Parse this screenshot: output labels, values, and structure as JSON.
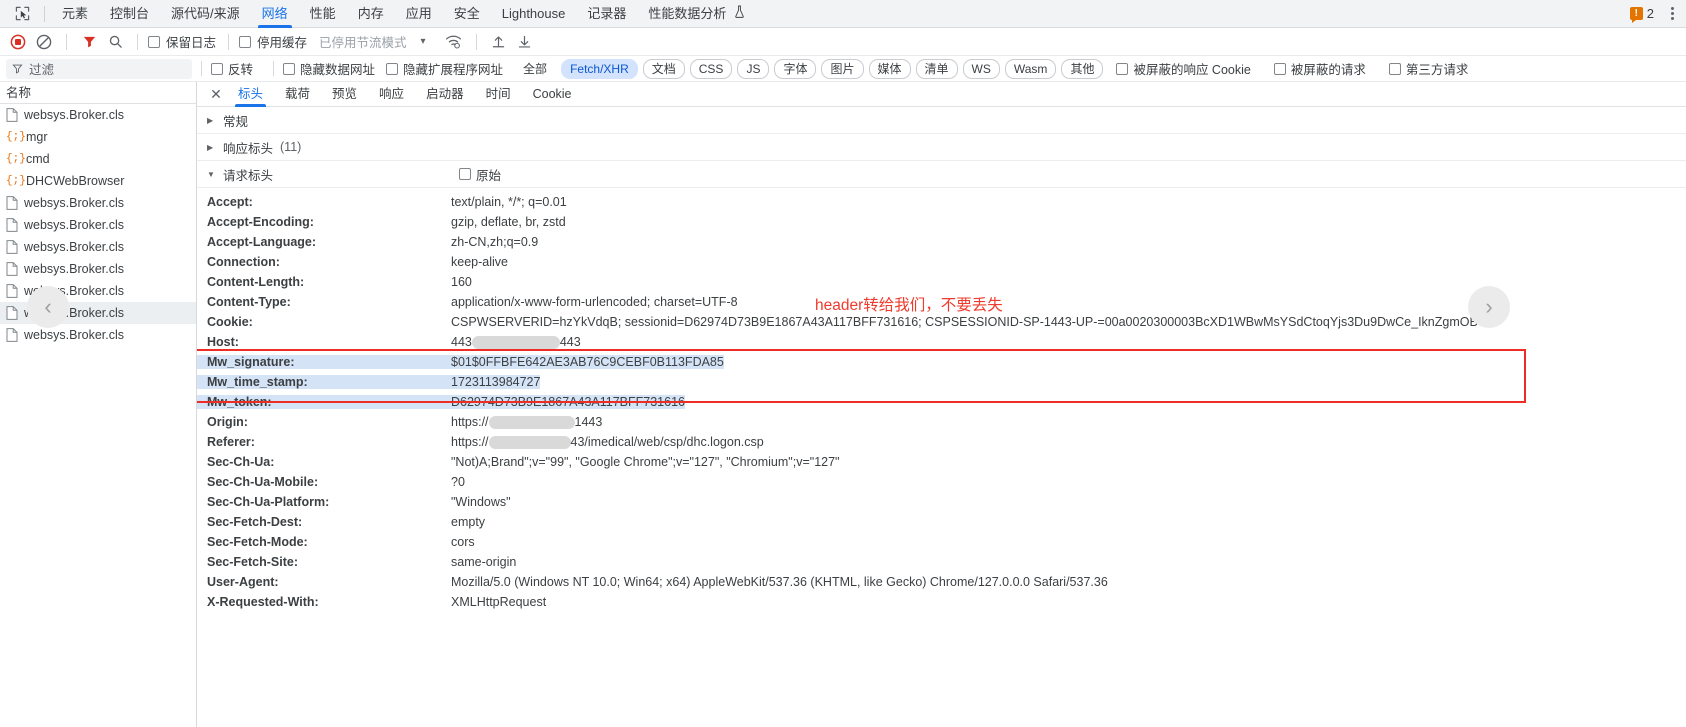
{
  "devtools": {
    "tabs": [
      {
        "label": "元素",
        "active": false
      },
      {
        "label": "控制台",
        "active": false
      },
      {
        "label": "源代码/来源",
        "active": false
      },
      {
        "label": "网络",
        "active": true
      },
      {
        "label": "性能",
        "active": false
      },
      {
        "label": "内存",
        "active": false
      },
      {
        "label": "应用",
        "active": false
      },
      {
        "label": "安全",
        "active": false
      },
      {
        "label": "Lighthouse",
        "active": false
      },
      {
        "label": "记录器",
        "active": false
      },
      {
        "label": "性能数据分析",
        "active": false
      }
    ],
    "flask_icon": "flask-icon",
    "inspect_icon": "inspect-element-icon",
    "warning_count": "2",
    "warning_badge_glyph": "!",
    "more_icon": "kebab-menu-icon"
  },
  "toolbar": {
    "record_icon": "record-stop-icon",
    "clear_icon": "clear-network-log-icon",
    "filter_icon": "filter-funnel-icon",
    "search_icon": "search-icon",
    "preserve_log": "保留日志",
    "disable_cache": "停用缓存",
    "throttling": "已停用节流模式",
    "throttle_caret": "▾",
    "wifi_icon": "network-conditions-icon",
    "import_icon": "import-har-icon",
    "export_icon": "export-har-icon"
  },
  "filterbar": {
    "filter_placeholder": "过滤",
    "filter_value": "",
    "invert": "反转",
    "hide_data_urls": "隐藏数据网址",
    "hide_extension_urls": "隐藏扩展程序网址",
    "types": [
      {
        "label": "全部",
        "selected": false
      },
      {
        "label": "Fetch/XHR",
        "selected": true
      },
      {
        "label": "文档",
        "selected": false
      },
      {
        "label": "CSS",
        "selected": false
      },
      {
        "label": "JS",
        "selected": false
      },
      {
        "label": "字体",
        "selected": false
      },
      {
        "label": "图片",
        "selected": false
      },
      {
        "label": "媒体",
        "selected": false
      },
      {
        "label": "清单",
        "selected": false
      },
      {
        "label": "WS",
        "selected": false
      },
      {
        "label": "Wasm",
        "selected": false
      },
      {
        "label": "其他",
        "selected": false
      }
    ],
    "blocked_cookies": "被屏蔽的响应 Cookie",
    "blocked_requests": "被屏蔽的请求",
    "third_party": "第三方请求"
  },
  "sidebar": {
    "header": "名称",
    "rows": [
      {
        "name": "websys.Broker.cls",
        "icon": "document-icon",
        "selected": false
      },
      {
        "name": "mgr",
        "icon": "js-icon",
        "selected": false
      },
      {
        "name": "cmd",
        "icon": "js-icon",
        "selected": false
      },
      {
        "name": "DHCWebBrowser",
        "icon": "js-icon",
        "selected": false
      },
      {
        "name": "websys.Broker.cls",
        "icon": "document-icon",
        "selected": false
      },
      {
        "name": "websys.Broker.cls",
        "icon": "document-icon",
        "selected": false
      },
      {
        "name": "websys.Broker.cls",
        "icon": "document-icon",
        "selected": false
      },
      {
        "name": "websys.Broker.cls",
        "icon": "document-icon",
        "selected": false
      },
      {
        "name": "websys.Broker.cls",
        "icon": "document-icon",
        "selected": false
      },
      {
        "name": "websys.Broker.cls",
        "icon": "document-icon",
        "selected": true
      },
      {
        "name": "websys.Broker.cls",
        "icon": "document-icon",
        "selected": false
      }
    ]
  },
  "detail": {
    "close_icon": "close-icon",
    "tabs": [
      {
        "label": "标头",
        "active": true
      },
      {
        "label": "载荷",
        "active": false
      },
      {
        "label": "预览",
        "active": false
      },
      {
        "label": "响应",
        "active": false
      },
      {
        "label": "启动器",
        "active": false
      },
      {
        "label": "时间",
        "active": false
      },
      {
        "label": "Cookie",
        "active": false
      }
    ],
    "sections": [
      {
        "label": "常规",
        "expanded": false,
        "count": ""
      },
      {
        "label": "响应标头",
        "expanded": false,
        "count": "(11)"
      },
      {
        "label": "请求标头",
        "expanded": true,
        "count": ""
      }
    ],
    "raw_label": "原始",
    "request_headers": [
      {
        "name": "Accept:",
        "value": "text/plain, */*; q=0.01",
        "highlight": false,
        "redacted": false
      },
      {
        "name": "Accept-Encoding:",
        "value": "gzip, deflate, br, zstd",
        "highlight": false,
        "redacted": false
      },
      {
        "name": "Accept-Language:",
        "value": "zh-CN,zh;q=0.9",
        "highlight": false,
        "redacted": false
      },
      {
        "name": "Connection:",
        "value": "keep-alive",
        "highlight": false,
        "redacted": false
      },
      {
        "name": "Content-Length:",
        "value": "160",
        "highlight": false,
        "redacted": false
      },
      {
        "name": "Content-Type:",
        "value": "application/x-www-form-urlencoded; charset=UTF-8",
        "highlight": false,
        "redacted": false
      },
      {
        "name": "Cookie:",
        "value": "CSPWSERVERID=hzYkVdqB; sessionid=D62974D73B9E1867A43A117BFF731616; CSPSESSIONID-SP-1443-UP-=00a0020300003BcXD1WBwMsYSdCtoqYjs3Du9DwCe_IknZgmOB",
        "highlight": false,
        "redacted": false
      },
      {
        "name": "Host:",
        "value": "443",
        "highlight": false,
        "redacted": true
      },
      {
        "name": "Mw_signature:",
        "value": "$01$0FFBFE642AE3AB76C9CEBF0B113FDA85",
        "highlight": true,
        "redacted": false
      },
      {
        "name": "Mw_time_stamp:",
        "value": "1723113984727",
        "highlight": true,
        "redacted": false
      },
      {
        "name": "Mw_token:",
        "value": "D62974D73B9E1867A43A117BFF731616",
        "highlight": true,
        "redacted": false
      },
      {
        "name": "Origin:",
        "value": "https://",
        "value_suffix": "1443",
        "highlight": false,
        "redacted": true
      },
      {
        "name": "Referer:",
        "value": "https://",
        "value_suffix": "43/imedical/web/csp/dhc.logon.csp",
        "highlight": false,
        "redacted": true
      },
      {
        "name": "Sec-Ch-Ua:",
        "value": "\"Not)A;Brand\";v=\"99\", \"Google Chrome\";v=\"127\", \"Chromium\";v=\"127\"",
        "highlight": false,
        "redacted": false
      },
      {
        "name": "Sec-Ch-Ua-Mobile:",
        "value": "?0",
        "highlight": false,
        "redacted": false
      },
      {
        "name": "Sec-Ch-Ua-Platform:",
        "value": "\"Windows\"",
        "highlight": false,
        "redacted": false
      },
      {
        "name": "Sec-Fetch-Dest:",
        "value": "empty",
        "highlight": false,
        "redacted": false
      },
      {
        "name": "Sec-Fetch-Mode:",
        "value": "cors",
        "highlight": false,
        "redacted": false
      },
      {
        "name": "Sec-Fetch-Site:",
        "value": "same-origin",
        "highlight": false,
        "redacted": false
      },
      {
        "name": "User-Agent:",
        "value": "Mozilla/5.0 (Windows NT 10.0; Win64; x64) AppleWebKit/537.36 (KHTML, like Gecko) Chrome/127.0.0.0 Safari/537.36",
        "highlight": false,
        "redacted": false
      },
      {
        "name": "X-Requested-With:",
        "value": "XMLHttpRequest",
        "highlight": false,
        "redacted": false
      }
    ]
  },
  "annotation": {
    "text": "header转给我们，不要丢失",
    "color": "#ef3b2d",
    "box_color": "#ee2d24"
  },
  "overlay": {
    "prev_arrow": "‹",
    "next_arrow": "›"
  }
}
